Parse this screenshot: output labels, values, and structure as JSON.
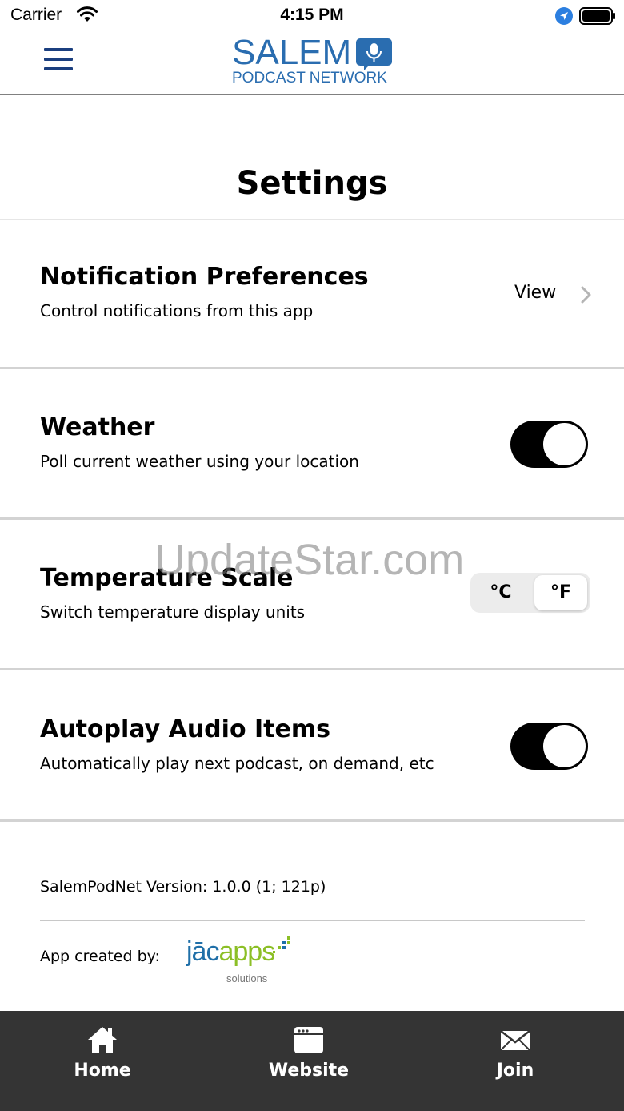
{
  "status_bar": {
    "carrier": "Carrier",
    "time": "4:15 PM",
    "icons": [
      "wifi-icon",
      "location-icon",
      "battery-icon"
    ]
  },
  "header": {
    "logo_top": "SALEM",
    "logo_bottom": "PODCAST NETWORK",
    "brand_color": "#2a6db0",
    "menu_icon": "menu-icon"
  },
  "page": {
    "title": "Settings"
  },
  "settings": {
    "notifications": {
      "title": "Notification Preferences",
      "subtitle": "Control notifications from this app",
      "action_label": "View"
    },
    "weather": {
      "title": "Weather",
      "subtitle": "Poll current weather using your location",
      "enabled": true
    },
    "temperature": {
      "title": "Temperature Scale",
      "subtitle": "Switch temperature display units",
      "options": [
        "°C",
        "°F"
      ],
      "selected": "°F"
    },
    "autoplay": {
      "title": "Autoplay Audio Items",
      "subtitle": "Automatically play next podcast, on demand, etc",
      "enabled": true
    }
  },
  "info": {
    "version": "SalemPodNet Version: 1.0.0 (1; 121p)",
    "created_by": "App created by:",
    "creator_logo": "jācapps",
    "creator_logo_sub": "solutions"
  },
  "watermark": "UpdateStar.com",
  "tabs": [
    {
      "label": "Home",
      "icon": "home-icon"
    },
    {
      "label": "Website",
      "icon": "browser-window-icon"
    },
    {
      "label": "Join",
      "icon": "envelope-icon"
    }
  ],
  "colors": {
    "tab_bar": "#343434",
    "toggle_on": "#000000",
    "jacapps_blue": "#1f6fa8",
    "jacapps_green": "#8cbf26"
  }
}
